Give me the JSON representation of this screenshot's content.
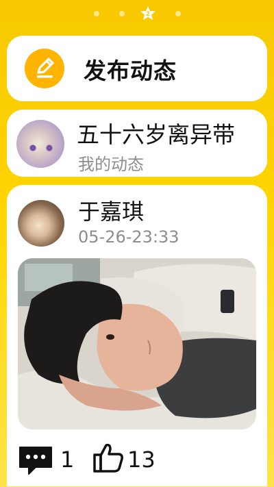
{
  "pager": {
    "active_icon": "star-badge-icon",
    "dots": 4
  },
  "post_button": {
    "label": "发布动态",
    "icon": "pencil-icon",
    "accent": "#ffb400"
  },
  "profile": {
    "name": "五十六岁离异带",
    "subtitle": "我的动态",
    "avatar_icon": "user-avatar"
  },
  "feed": {
    "author": "于嘉琪",
    "time": "05-26-23:33",
    "comment_count": "1",
    "like_count": "13",
    "comment_icon": "comment-icon",
    "like_icon": "thumbs-up-icon"
  },
  "colors": {
    "background": "#ffd400",
    "card": "#ffffff",
    "muted_text": "#8d8d8d"
  }
}
